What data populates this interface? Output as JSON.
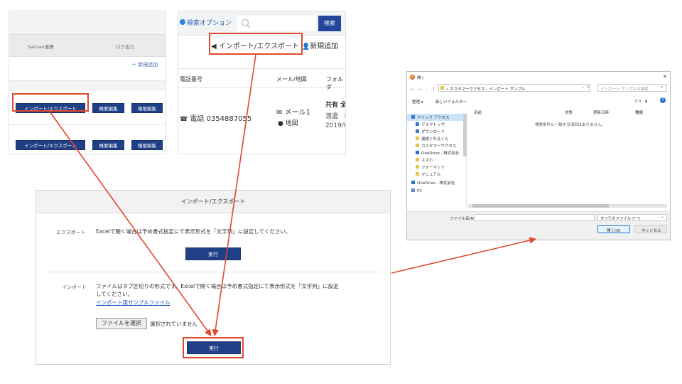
{
  "panel_admin": {
    "col_sansan": "Sansan連携",
    "col_log": "ログ出力",
    "add_new": "新規追加",
    "row1": {
      "import_export": "インポート/エクスポート",
      "summary_edit": "概要編集",
      "perm_edit": "権限編集"
    },
    "row2": {
      "import_export": "インポート/エクスポート",
      "summary_edit": "概要編集",
      "perm_edit": "権限編集"
    }
  },
  "panel_contacts": {
    "search_options": "検索オプション",
    "search_button": "検索",
    "import_export": "インポート/エクスポート",
    "add_new": "新規追加",
    "col_phone": "電話番号",
    "col_mail_map": "メール/地図",
    "col_folder": "フォルダ",
    "phone_label": "電話 0354887055",
    "mail_label": "メール1",
    "map_label": "地図",
    "folder_line1": "共有 全",
    "folder_line2": "渡邊　昭",
    "folder_line3": "2019/0"
  },
  "panel_import": {
    "title": "インポート/エクスポート",
    "export_label": "エクスポート",
    "export_desc": "Excelで開く場合は予め書式指定にて表示形式を「文字列」に設定してください。",
    "export_exec": "実行",
    "import_label": "インポート",
    "import_desc_1": "ファイルはタブ区切りの形式です。Excelで開く場合は予め書式指定にて表示形式を「文字列」に設定",
    "import_desc_2": "してください。",
    "sample_link": "インポート用サンプルファイル",
    "choose_file": "ファイルを選択",
    "no_file": "選択されていません",
    "import_exec": "実行"
  },
  "panel_dialog": {
    "title": "開く",
    "path": "« カスタマーサクセス › インポート サンプル",
    "search_placeholder": "インポート サンプルの検索",
    "organize": "整理 ▾",
    "new_folder": "新しいフォルダー",
    "col_name": "名前",
    "col_status": "状態",
    "col_date": "更新日時",
    "col_type": "種類",
    "empty_msg": "検索条件に一致する項目はありません。",
    "nav_items": [
      "クイック アクセス",
      "デスクトップ",
      "ダウンロード",
      "連絡とれるくん",
      "カスタマーサクセス",
      "OneDrive - 株式会社",
      "スマホ",
      "フォーマット",
      "マニュアル",
      "OneDrive - 株式会社",
      "PC"
    ],
    "filename_label": "ファイル名(N):",
    "filetype": "すべてのファイル (*.*)",
    "open_button": "開く(O)",
    "cancel_button": "キャンセル"
  },
  "colors": {
    "accent": "#1f3f86",
    "highlight": "#e0492b",
    "link": "#1a56c8"
  }
}
